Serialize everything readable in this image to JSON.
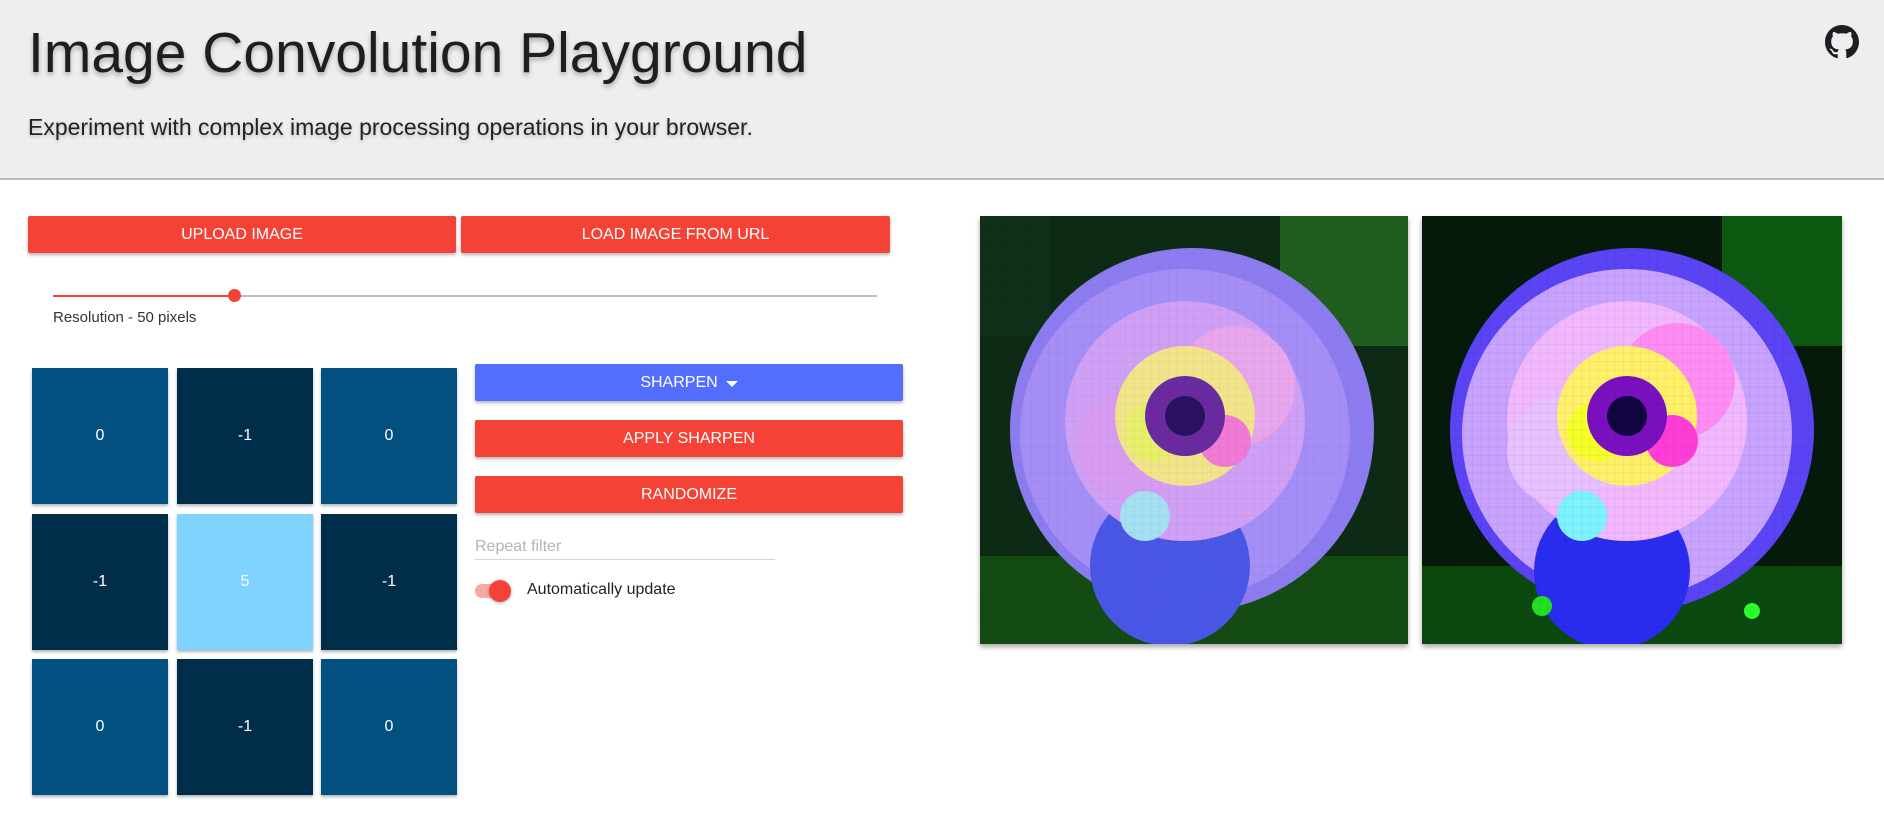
{
  "header": {
    "title": "Image Convolution Playground",
    "subtitle": "Experiment with complex image processing operations in your browser.",
    "github_icon": "github-icon"
  },
  "controls": {
    "upload_label": "UPLOAD IMAGE",
    "load_url_label": "LOAD IMAGE FROM URL",
    "resolution": {
      "label": "Resolution - 50 pixels",
      "value": 50,
      "fraction": 0.22
    }
  },
  "kernel": {
    "values": [
      "0",
      "-1",
      "0",
      "-1",
      "5",
      "-1",
      "0",
      "-1",
      "0"
    ]
  },
  "actions": {
    "filter_label": "SHARPEN",
    "apply_label": "APPLY SHARPEN",
    "randomize_label": "RANDOMIZE",
    "repeat_placeholder": "Repeat filter",
    "auto_update_label": "Automatically update",
    "auto_update_on": true
  },
  "colors": {
    "accent_red": "#f44336",
    "accent_blue": "#536dfe",
    "kernel_zero": "#01507f",
    "kernel_negative": "#002e4a",
    "kernel_positive": "#80d3ff"
  },
  "images": {
    "original_alt": "original-image",
    "processed_alt": "processed-image"
  }
}
